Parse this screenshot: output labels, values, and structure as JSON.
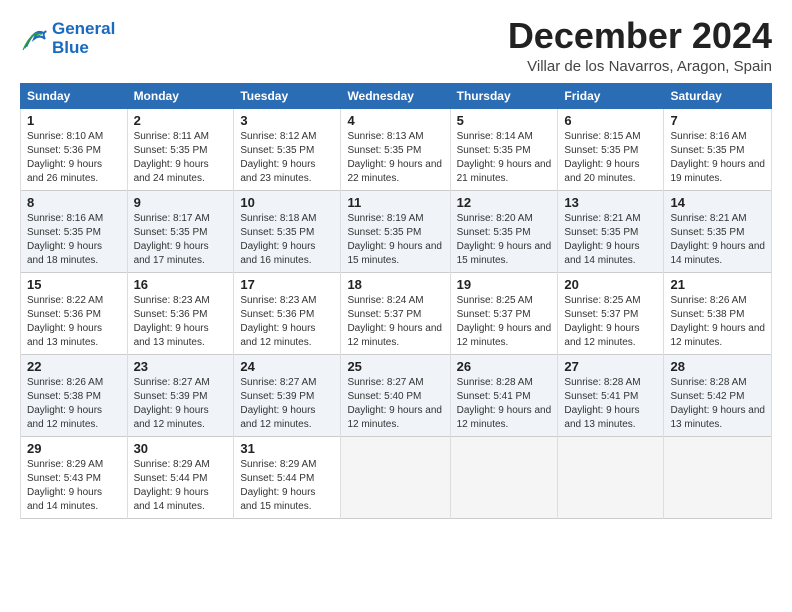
{
  "header": {
    "logo_line1": "General",
    "logo_line2": "Blue",
    "month_title": "December 2024",
    "location": "Villar de los Navarros, Aragon, Spain"
  },
  "weekdays": [
    "Sunday",
    "Monday",
    "Tuesday",
    "Wednesday",
    "Thursday",
    "Friday",
    "Saturday"
  ],
  "weeks": [
    [
      {
        "day": "1",
        "sunrise": "8:10 AM",
        "sunset": "5:36 PM",
        "daylight": "9 hours and 26 minutes."
      },
      {
        "day": "2",
        "sunrise": "8:11 AM",
        "sunset": "5:35 PM",
        "daylight": "9 hours and 24 minutes."
      },
      {
        "day": "3",
        "sunrise": "8:12 AM",
        "sunset": "5:35 PM",
        "daylight": "9 hours and 23 minutes."
      },
      {
        "day": "4",
        "sunrise": "8:13 AM",
        "sunset": "5:35 PM",
        "daylight": "9 hours and 22 minutes."
      },
      {
        "day": "5",
        "sunrise": "8:14 AM",
        "sunset": "5:35 PM",
        "daylight": "9 hours and 21 minutes."
      },
      {
        "day": "6",
        "sunrise": "8:15 AM",
        "sunset": "5:35 PM",
        "daylight": "9 hours and 20 minutes."
      },
      {
        "day": "7",
        "sunrise": "8:16 AM",
        "sunset": "5:35 PM",
        "daylight": "9 hours and 19 minutes."
      }
    ],
    [
      {
        "day": "8",
        "sunrise": "8:16 AM",
        "sunset": "5:35 PM",
        "daylight": "9 hours and 18 minutes."
      },
      {
        "day": "9",
        "sunrise": "8:17 AM",
        "sunset": "5:35 PM",
        "daylight": "9 hours and 17 minutes."
      },
      {
        "day": "10",
        "sunrise": "8:18 AM",
        "sunset": "5:35 PM",
        "daylight": "9 hours and 16 minutes."
      },
      {
        "day": "11",
        "sunrise": "8:19 AM",
        "sunset": "5:35 PM",
        "daylight": "9 hours and 15 minutes."
      },
      {
        "day": "12",
        "sunrise": "8:20 AM",
        "sunset": "5:35 PM",
        "daylight": "9 hours and 15 minutes."
      },
      {
        "day": "13",
        "sunrise": "8:21 AM",
        "sunset": "5:35 PM",
        "daylight": "9 hours and 14 minutes."
      },
      {
        "day": "14",
        "sunrise": "8:21 AM",
        "sunset": "5:35 PM",
        "daylight": "9 hours and 14 minutes."
      }
    ],
    [
      {
        "day": "15",
        "sunrise": "8:22 AM",
        "sunset": "5:36 PM",
        "daylight": "9 hours and 13 minutes."
      },
      {
        "day": "16",
        "sunrise": "8:23 AM",
        "sunset": "5:36 PM",
        "daylight": "9 hours and 13 minutes."
      },
      {
        "day": "17",
        "sunrise": "8:23 AM",
        "sunset": "5:36 PM",
        "daylight": "9 hours and 12 minutes."
      },
      {
        "day": "18",
        "sunrise": "8:24 AM",
        "sunset": "5:37 PM",
        "daylight": "9 hours and 12 minutes."
      },
      {
        "day": "19",
        "sunrise": "8:25 AM",
        "sunset": "5:37 PM",
        "daylight": "9 hours and 12 minutes."
      },
      {
        "day": "20",
        "sunrise": "8:25 AM",
        "sunset": "5:37 PM",
        "daylight": "9 hours and 12 minutes."
      },
      {
        "day": "21",
        "sunrise": "8:26 AM",
        "sunset": "5:38 PM",
        "daylight": "9 hours and 12 minutes."
      }
    ],
    [
      {
        "day": "22",
        "sunrise": "8:26 AM",
        "sunset": "5:38 PM",
        "daylight": "9 hours and 12 minutes."
      },
      {
        "day": "23",
        "sunrise": "8:27 AM",
        "sunset": "5:39 PM",
        "daylight": "9 hours and 12 minutes."
      },
      {
        "day": "24",
        "sunrise": "8:27 AM",
        "sunset": "5:39 PM",
        "daylight": "9 hours and 12 minutes."
      },
      {
        "day": "25",
        "sunrise": "8:27 AM",
        "sunset": "5:40 PM",
        "daylight": "9 hours and 12 minutes."
      },
      {
        "day": "26",
        "sunrise": "8:28 AM",
        "sunset": "5:41 PM",
        "daylight": "9 hours and 12 minutes."
      },
      {
        "day": "27",
        "sunrise": "8:28 AM",
        "sunset": "5:41 PM",
        "daylight": "9 hours and 13 minutes."
      },
      {
        "day": "28",
        "sunrise": "8:28 AM",
        "sunset": "5:42 PM",
        "daylight": "9 hours and 13 minutes."
      }
    ],
    [
      {
        "day": "29",
        "sunrise": "8:29 AM",
        "sunset": "5:43 PM",
        "daylight": "9 hours and 14 minutes."
      },
      {
        "day": "30",
        "sunrise": "8:29 AM",
        "sunset": "5:44 PM",
        "daylight": "9 hours and 14 minutes."
      },
      {
        "day": "31",
        "sunrise": "8:29 AM",
        "sunset": "5:44 PM",
        "daylight": "9 hours and 15 minutes."
      },
      null,
      null,
      null,
      null
    ]
  ],
  "labels": {
    "sunrise": "Sunrise:",
    "sunset": "Sunset:",
    "daylight": "Daylight:"
  }
}
